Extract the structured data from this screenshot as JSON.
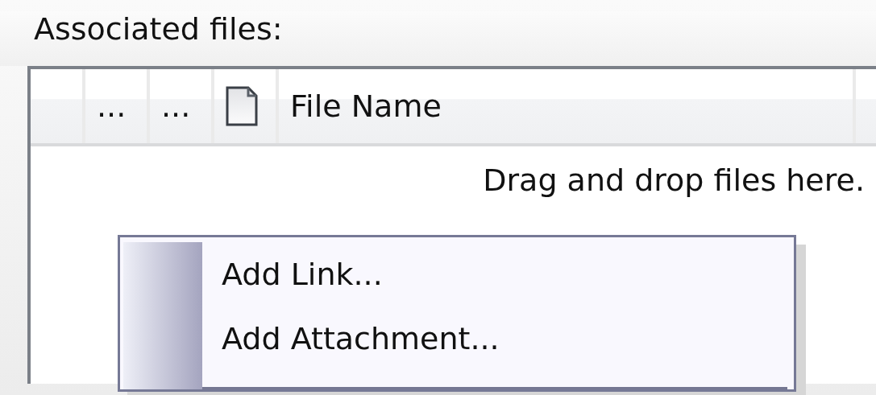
{
  "label": "Associated files:",
  "list": {
    "columns": [
      {
        "kind": "text",
        "label": "..."
      },
      {
        "kind": "text",
        "label": "..."
      },
      {
        "kind": "icon"
      },
      {
        "kind": "text",
        "label": "File Name"
      }
    ],
    "empty_text": "Drag and drop files here."
  },
  "context_menu": {
    "items": [
      {
        "kind": "command",
        "label": "Add Link..."
      },
      {
        "kind": "command",
        "label": "Add Attachment..."
      },
      {
        "kind": "separator"
      }
    ]
  }
}
